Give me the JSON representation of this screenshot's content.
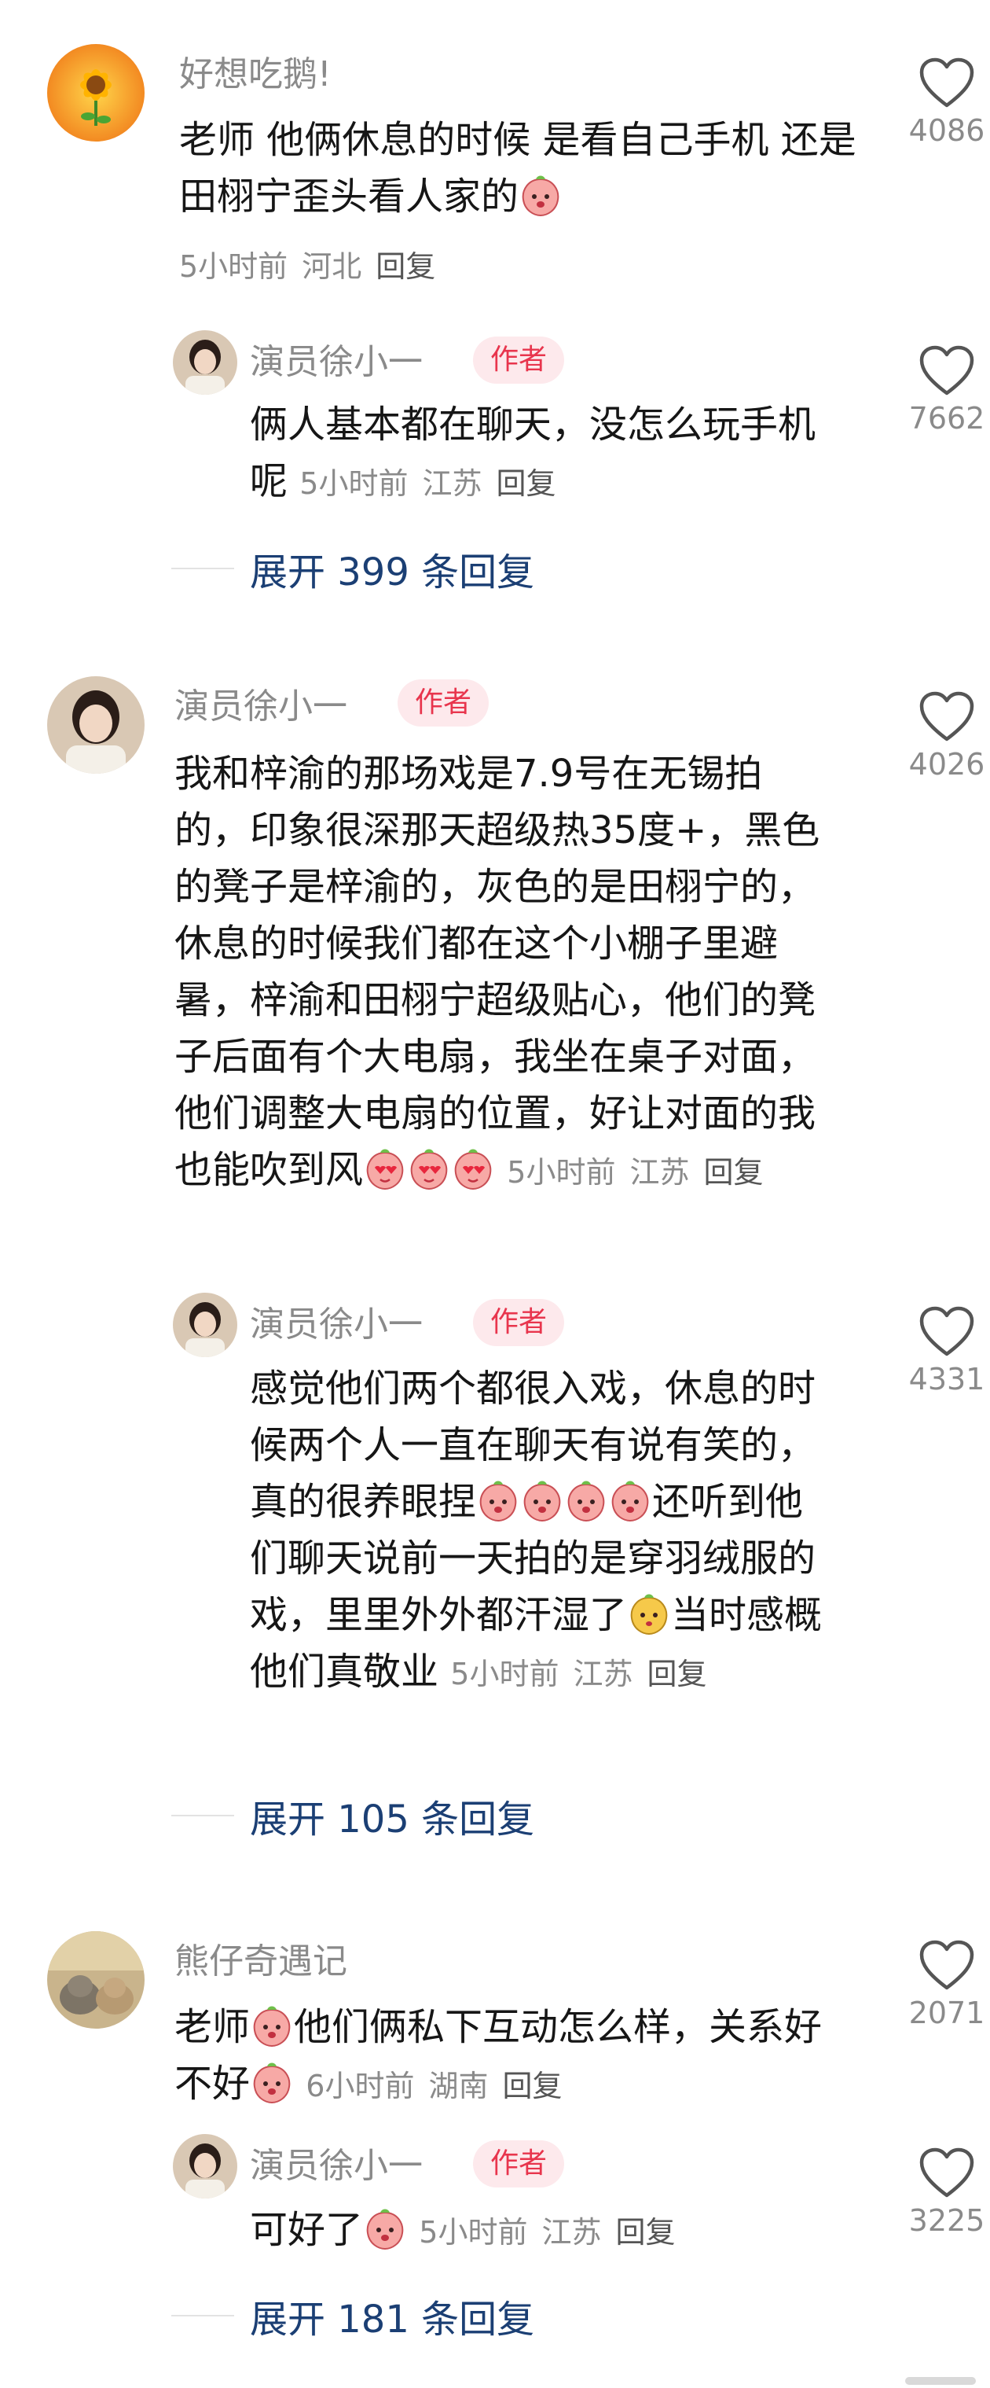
{
  "author_badge": "作者",
  "reply_label": "回复",
  "comments": [
    {
      "username": "好想吃鹅!",
      "text": "老师 他俩休息的时候 是看自己手机 还是田栩宁歪头看人家的",
      "time": "5小时前",
      "location": "河北",
      "likes": "4086",
      "reply": {
        "username": "演员徐小一",
        "text": "俩人基本都在聊天，没怎么玩手机呢",
        "time": "5小时前",
        "location": "江苏",
        "likes": "7662"
      },
      "expand_label": "展开 399 条回复"
    },
    {
      "username": "演员徐小一",
      "text": "我和梓渝的那场戏是7.9号在无锡拍的，印象很深那天超级热35度+，黑色的凳子是梓渝的，灰色的是田栩宁的，休息的时候我们都在这个小棚子里避暑，梓渝和田栩宁超级贴心，他们的凳子后面有个大电扇，我坐在桌子对面，他们调整大电扇的位置，好让对面的我也能吹到风",
      "time": "5小时前",
      "location": "江苏",
      "likes": "4026",
      "reply": {
        "username": "演员徐小一",
        "text_a": "感觉他们两个都很入戏，休息的时候两个人一直在聊天有说有笑的，真的很养眼捏",
        "text_b": "还听到他们聊天说前一天拍的是穿羽绒服的戏，里里外外都汗湿了",
        "text_c": "当时感概他们真敬业",
        "time": "5小时前",
        "location": "江苏",
        "likes": "4331"
      },
      "expand_label": "展开 105 条回复"
    },
    {
      "username": "熊仔奇遇记",
      "text_a": "老师",
      "text_b": "他们俩私下互动怎么样，关系好不好",
      "time": "6小时前",
      "location": "湖南",
      "likes": "2071",
      "reply": {
        "username": "演员徐小一",
        "text": "可好了",
        "time": "5小时前",
        "location": "江苏",
        "likes": "3225"
      },
      "expand_label": "展开 181 条回复"
    }
  ]
}
